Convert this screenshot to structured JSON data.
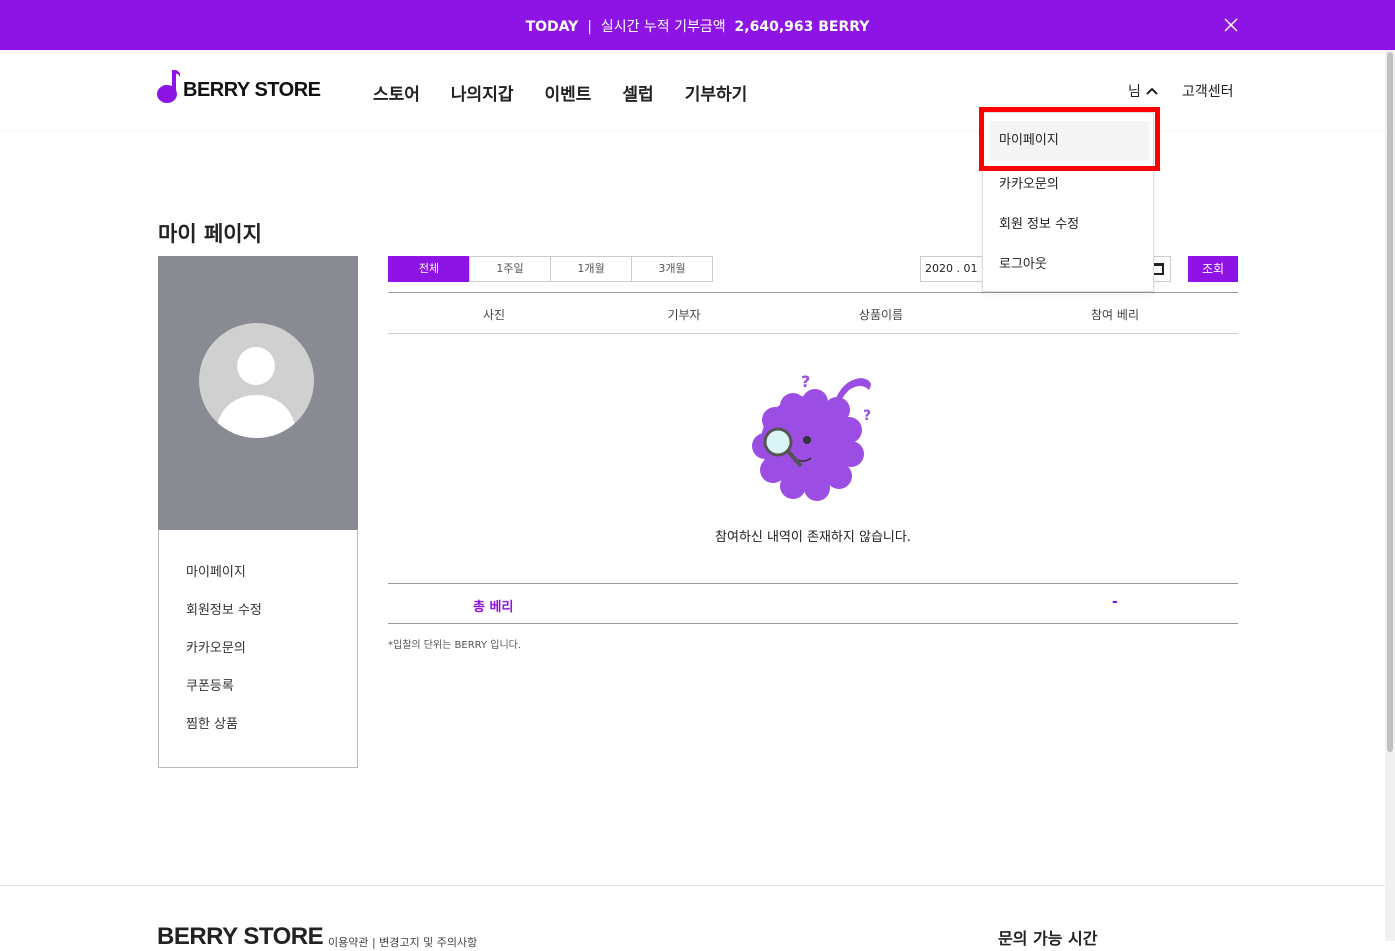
{
  "banner": {
    "today": "TODAY",
    "sep": "|",
    "label": "실시간 누적 기부금액",
    "amount": "2,640,963 BERRY"
  },
  "header": {
    "logo_text": "BERRY STORE",
    "nav": [
      "스토어",
      "나의지갑",
      "이벤트",
      "셀럽",
      "기부하기"
    ],
    "user_label": "님",
    "support": "고객센터"
  },
  "dropdown": {
    "items": [
      "마이페이지",
      "카카오문의",
      "회원 정보 수정",
      "로그아웃"
    ]
  },
  "page": {
    "title": "마이 페이지"
  },
  "sidebar": {
    "items": [
      "마이페이지",
      "회원정보 수정",
      "카카오문의",
      "쿠폰등록",
      "찜한 상품"
    ]
  },
  "filters": {
    "tabs": [
      "전체",
      "1주일",
      "1개월",
      "3개월"
    ],
    "active": 0,
    "date_value": "2020 . 01 .",
    "search_label": "조회"
  },
  "table": {
    "columns": [
      "사진",
      "기부자",
      "상품이름",
      "참여 베리"
    ],
    "empty_message": "참여하신 내역이 존재하지 않습니다."
  },
  "total": {
    "label": "총 베리",
    "value": "-"
  },
  "note": "*입찰의 단위는 BERRY 입니다.",
  "footer": {
    "logo_text": "BERRY STORE",
    "links": "이용약관  |  변경고지 및 주의사항",
    "hours_title": "문의 가능 시간"
  },
  "colors": {
    "brand": "#8e14e6",
    "highlight": "#ff0000"
  }
}
